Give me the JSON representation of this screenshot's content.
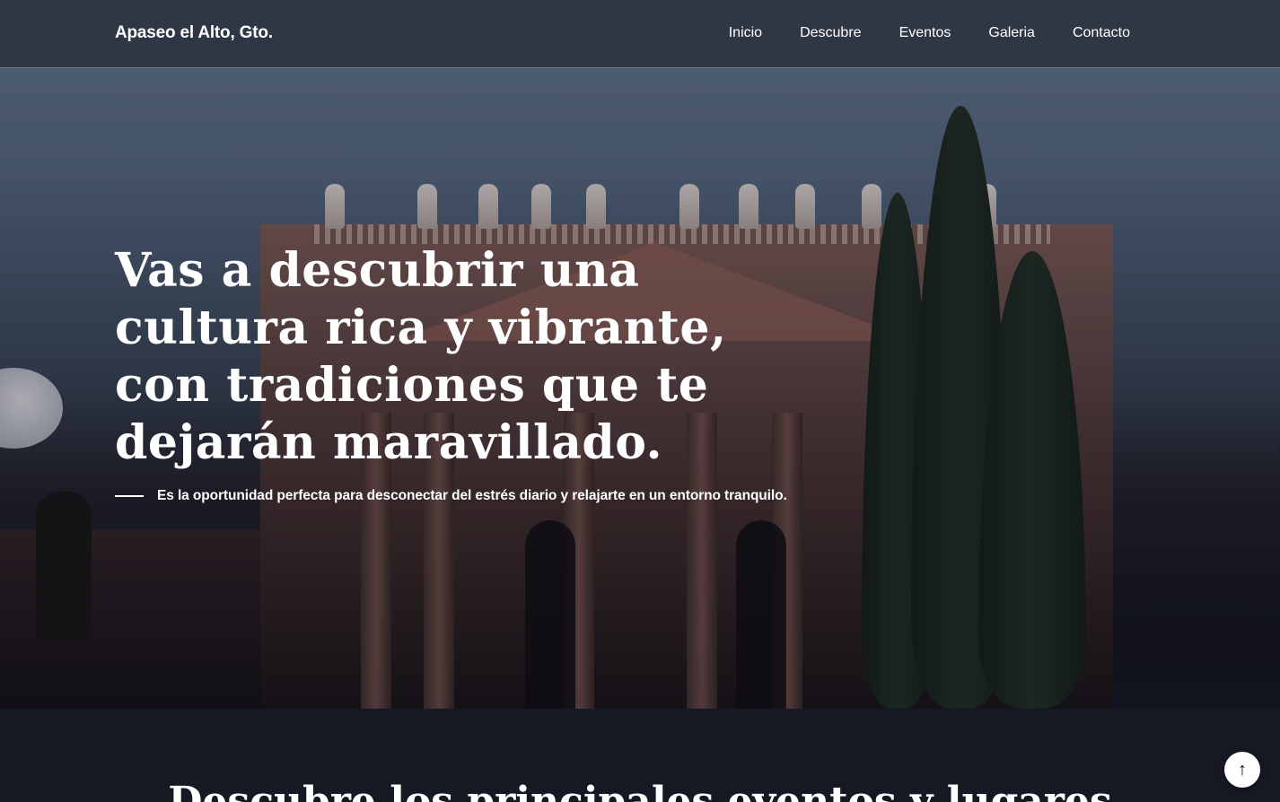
{
  "navbar": {
    "brand": "Apaseo el Alto, Gto.",
    "links": [
      {
        "label": "Inicio"
      },
      {
        "label": "Descubre"
      },
      {
        "label": "Eventos"
      },
      {
        "label": "Galeria"
      },
      {
        "label": "Contacto"
      }
    ]
  },
  "hero": {
    "title": "Vas a descubrir una cultura rica y vibrante, con tradiciones que te dejarán maravillado.",
    "subtitle": "Es la oportunidad perfecta para desconectar del estrés diario y relajarte en un entorno tranquilo."
  },
  "section": {
    "title": "Descubre los principales eventos y lugares"
  },
  "scroll_top": {
    "icon": "arrow-up-icon",
    "glyph": "↑"
  },
  "colors": {
    "page_background": "#151924",
    "navbar_background": "#2d3440",
    "text": "#ffffff"
  }
}
